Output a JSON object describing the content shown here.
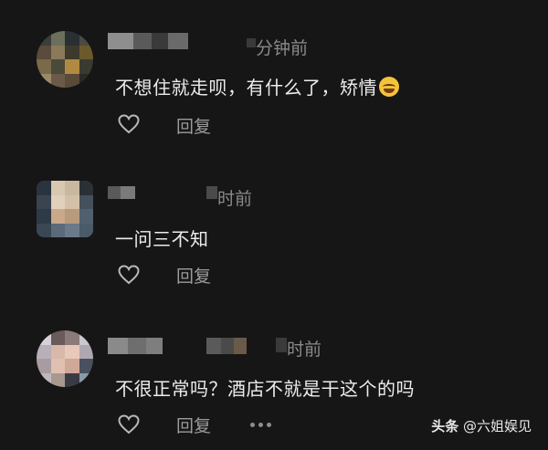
{
  "comments": [
    {
      "time": "分钟前",
      "text": "不想住就走呗，有什么了，矫情",
      "emoji": "laughing-crying-emoji",
      "reply_label": "回复"
    },
    {
      "time": "时前",
      "text": "一问三不知",
      "reply_label": "回复"
    },
    {
      "time": "时前",
      "text": "不很正常吗？酒店不就是干这个的吗",
      "reply_label": "回复"
    }
  ],
  "watermark": {
    "brand": "头条",
    "account": "@六姐娱见"
  },
  "colors": {
    "background": "#161616",
    "text": "#ececec",
    "muted": "#8a8a8a"
  }
}
